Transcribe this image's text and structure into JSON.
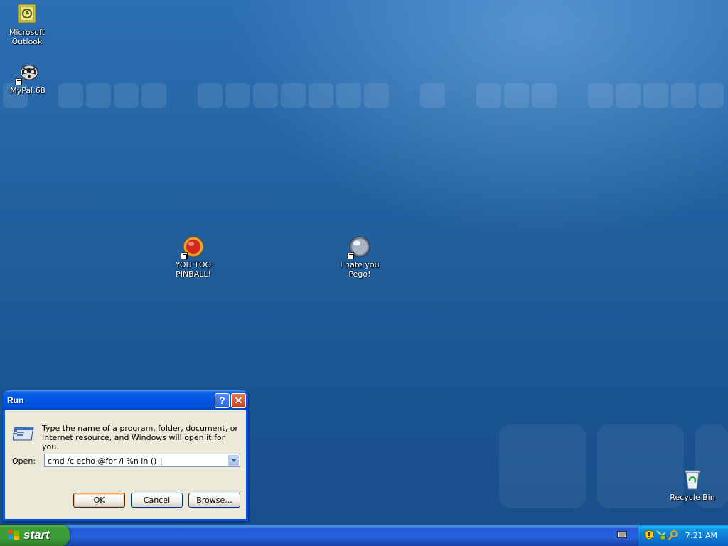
{
  "desktop": {
    "icons": [
      {
        "label_line1": "Microsoft",
        "label_line2": "Outlook",
        "icon": "outlook-icon"
      },
      {
        "label_line1": "MyPal 68",
        "label_line2": "",
        "icon": "raccoon-icon"
      },
      {
        "label_line1": "YOU TOO",
        "label_line2": "PINBALL!",
        "icon": "red-ball-icon"
      },
      {
        "label_line1": "I hate you",
        "label_line2": "Pego!",
        "icon": "silver-ball-icon"
      },
      {
        "label_line1": "Recycle Bin",
        "label_line2": "",
        "icon": "recycle-bin-icon"
      }
    ]
  },
  "run_dialog": {
    "title": "Run",
    "help_label": "?",
    "close_label": "✕",
    "description": "Type the name of a program, folder, document, or Internet resource, and Windows will open it for you.",
    "open_label": "Open:",
    "open_value": "cmd /c echo @for /l %n in () ",
    "ok_label": "OK",
    "cancel_label": "Cancel",
    "browse_label": "Browse..."
  },
  "taskbar": {
    "start_label": "start",
    "clock": "7:21 AM"
  },
  "colors": {
    "desktop_blue": "#22629f",
    "titlebar_blue": "#0054e3",
    "start_green": "#3c9e37",
    "dialog_face": "#ece9d8"
  }
}
